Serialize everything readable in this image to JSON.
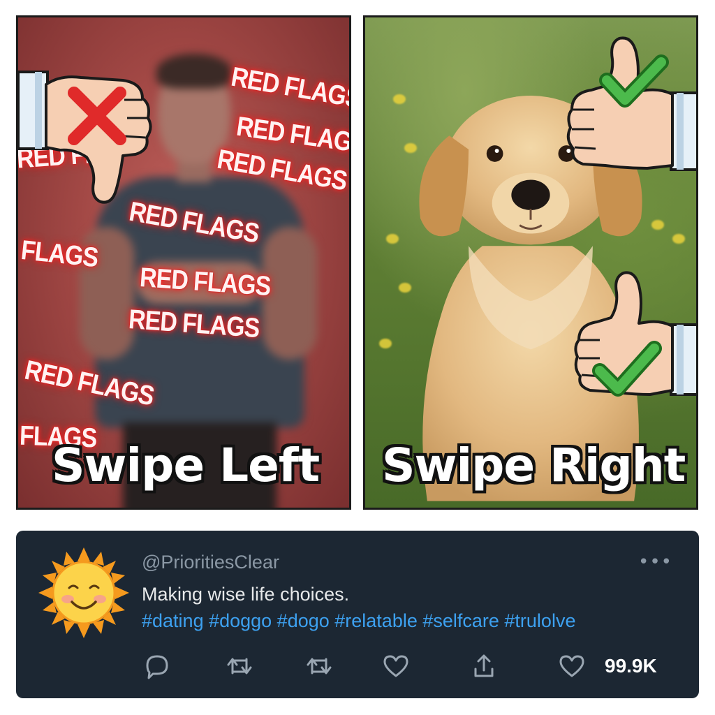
{
  "meme": {
    "left": {
      "caption": "Swipe Left",
      "flags": [
        "RED FLAGS",
        "RED FLAGS",
        "RED FLAGS",
        "RED FLAGS",
        "FLAGS",
        "RED FLAGS",
        "RED FLAGS",
        "RED FLAGS",
        "RED FL",
        "FLAGS"
      ],
      "hand_icon": "thumbs-down-red-x-icon"
    },
    "right": {
      "caption": "Swipe Right",
      "hand_icons": [
        "thumbs-up-green-check-icon",
        "thumbs-up-green-check-icon"
      ]
    }
  },
  "tweet": {
    "avatar_icon": "smiling-sun-icon",
    "handle": "@PrioritiesClear",
    "text": "Making wise life choices.",
    "hashtags": "#dating #doggo #dogo #relatable #selfcare #trulolve",
    "actions": [
      "reply-icon",
      "retweet-icon",
      "retweet-icon",
      "like-icon",
      "share-icon",
      "like-icon"
    ],
    "like_count": "99.9K",
    "more_icon": "more-dots-icon"
  },
  "colors": {
    "card_bg": "#1c2733",
    "hashtag": "#3da1f0",
    "handle": "#8b98a5",
    "red_glow": "#ff2b2b",
    "check_green": "#47b247"
  }
}
